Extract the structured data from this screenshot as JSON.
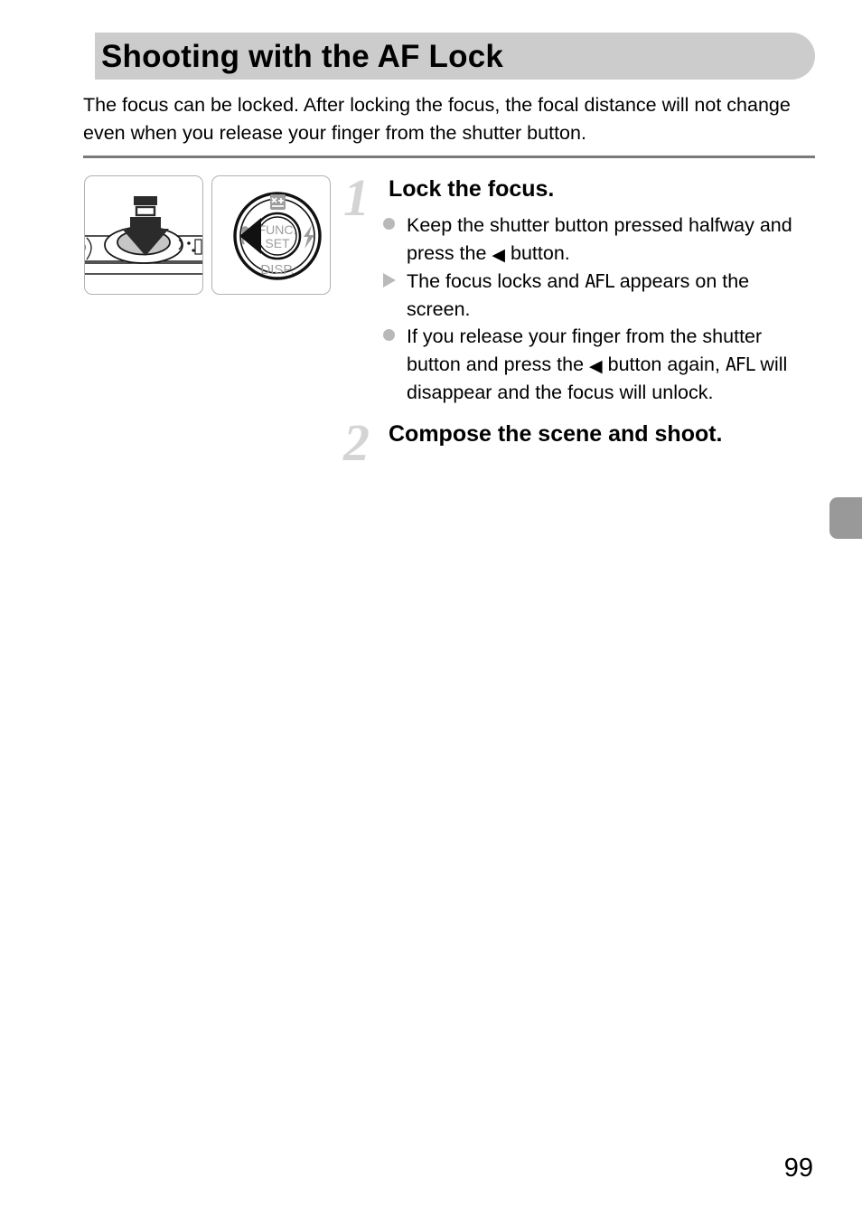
{
  "page": {
    "number": "99",
    "side_tab_color": "#999999",
    "header_bar_color": "#cccccc",
    "bullet_color": "#b9b9b9",
    "step_number_color": "#d4d4d4",
    "divider_color": "#7a7a7a"
  },
  "header": {
    "title": "Shooting with the AF Lock"
  },
  "intro": {
    "text": "The focus can be locked. After locking the focus, the focal distance will not change even when you release your finger from the shutter button."
  },
  "illustrations": {
    "shutter_panel": {
      "name": "camera-shutter-button-illustration",
      "caption_icons": [
        "shutter-button",
        "down-arrow"
      ]
    },
    "dial_panel": {
      "name": "camera-control-dial-illustration",
      "center_label_line1": "FUNC.",
      "center_label_line2": "SET",
      "bottom_label": "DISP.",
      "top_icon": "exposure-compensation-icon",
      "left_icon": "macro-flower-icon",
      "right_icon": "flash-bolt-icon",
      "highlight": "left-arrow-highlight"
    }
  },
  "steps": [
    {
      "number": "1",
      "heading": "Lock the focus.",
      "bullets": [
        {
          "marker": "dot",
          "parts": [
            {
              "type": "text",
              "value": "Keep the shutter button pressed halfway and press the "
            },
            {
              "type": "glyph",
              "value": "◀",
              "name": "left-button-glyph"
            },
            {
              "type": "text",
              "value": " button."
            }
          ],
          "plain": "Keep the shutter button pressed halfway and press the ◀ button."
        },
        {
          "marker": "triangle",
          "parts": [
            {
              "type": "text",
              "value": "The focus locks and "
            },
            {
              "type": "afl",
              "value": "AFL",
              "name": "afl-indicator-glyph"
            },
            {
              "type": "text",
              "value": " appears on the screen."
            }
          ],
          "plain": "The focus locks and AFL appears on the screen."
        },
        {
          "marker": "dot",
          "parts": [
            {
              "type": "text",
              "value": "If you release your finger from the shutter button and press the "
            },
            {
              "type": "glyph",
              "value": "◀",
              "name": "left-button-glyph"
            },
            {
              "type": "text",
              "value": " button again, "
            },
            {
              "type": "afl",
              "value": "AFL",
              "name": "afl-indicator-glyph"
            },
            {
              "type": "text",
              "value": " will disappear and the focus will unlock."
            }
          ],
          "plain": "If you release your finger from the shutter button and press the ◀ button again, AFL will disappear and the focus will unlock."
        }
      ]
    },
    {
      "number": "2",
      "heading": "Compose the scene and shoot.",
      "bullets": []
    }
  ]
}
